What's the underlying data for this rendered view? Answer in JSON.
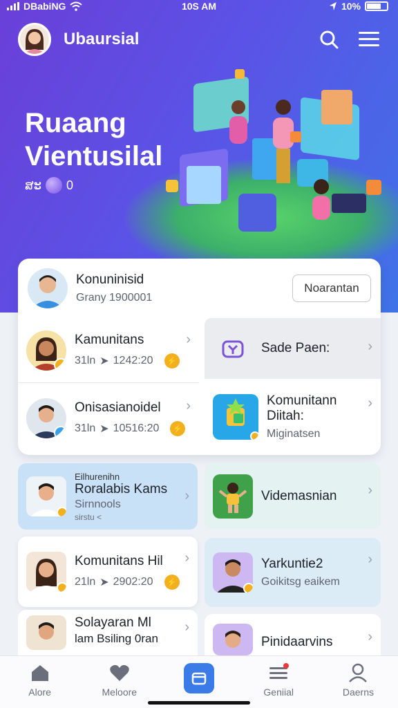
{
  "status": {
    "carrier": "DBabiNG",
    "time": "10S AM",
    "battery": "10%"
  },
  "header": {
    "app_title": "Ubaursial"
  },
  "hero": {
    "title_line1": "Ruaang",
    "title_line2": "Vientusilal",
    "sub_prefix": "ສະ",
    "sub_count": "0"
  },
  "featured": {
    "name": "Konuninisid",
    "sub": "Grany 1900001",
    "button": "Noarantan"
  },
  "left_items": [
    {
      "title": "Kamunitans",
      "meta_prefix": "31ln",
      "meta_time": "1242:20"
    },
    {
      "title": "Onisasianoidel",
      "meta_prefix": "31ln",
      "meta_time": "10516:20"
    }
  ],
  "right_items": [
    {
      "title": "Sade Paen:"
    },
    {
      "title": "Komunitann",
      "title2": "Diitah:",
      "sub": "Miginatsen"
    }
  ],
  "cards_row1_left": {
    "kicker": "Eilhurenihn",
    "title": "Roralabis Kams",
    "sub": "Sirnnools",
    "meta": "sirstu <"
  },
  "cards_row1_right": {
    "title": "Videmasnian"
  },
  "cards_row2_left": {
    "title": "Komunitans Hil",
    "meta_prefix": "21ln",
    "meta_time": "2902:20"
  },
  "cards_row2_right": {
    "title": "Yarkuntie2",
    "sub": "Goikitsg eaikem"
  },
  "cards_row3_left": {
    "title": "Solayaran Ml",
    "sub": "lam Bsiling 0ran"
  },
  "cards_row3_right": {
    "title": "Pinidaarvins"
  },
  "bottom_nav": [
    {
      "label": "Alore",
      "icon": "home-icon"
    },
    {
      "label": "Meloore",
      "icon": "heart-icon"
    },
    {
      "label": "",
      "icon": "window-icon"
    },
    {
      "label": "Geniial",
      "icon": "menu-icon"
    },
    {
      "label": "Daerns",
      "icon": "profile-icon"
    }
  ],
  "colors": {
    "accent": "#3b7be8",
    "hero_start": "#6a3fd8",
    "hero_end": "#3f73e8",
    "coin": "#f2b01e"
  }
}
